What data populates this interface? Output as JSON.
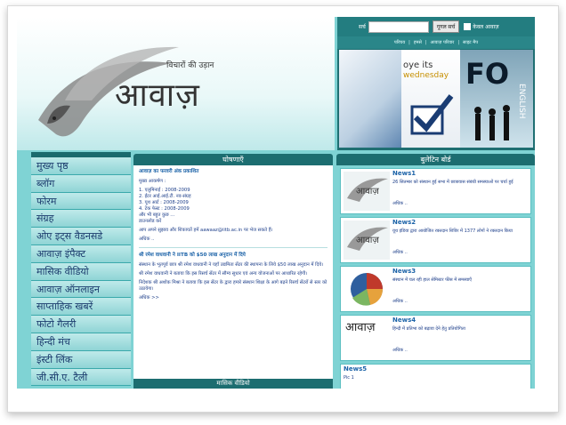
{
  "header": {
    "tagline": "विचारों की उड़ान",
    "logo_text": "आवाज़"
  },
  "search": {
    "label": "सर्च",
    "placeholder": "",
    "button": "गूगल सर्च",
    "checkbox_label": "केवल आवाज़"
  },
  "topnav": [
    "परिचय",
    "हमसे",
    "आवाज़ परिवार",
    "साइट मैप"
  ],
  "banner": {
    "line1": "oye its",
    "line2": "wednesday",
    "big": "FO",
    "vertical": "ENGLISH"
  },
  "sidebar": {
    "items": [
      "मुख्य पृष्ठ",
      "ब्लॉग",
      "फोरम",
      "संग्रह",
      "ओए इट्स वैडनसडे",
      "आवाज़ इंपैक्ट",
      "मासिक वीडियो",
      "आवाज़ ऑनलाइन",
      "साप्ताहिक खबरें",
      "फोटो गैलरी",
      "हिन्दी मंच",
      "इंस्टी लिंक",
      "जी.सी.ए. टैली"
    ]
  },
  "announcements": {
    "title": "घोषणाएँ",
    "item1_title": "आवाज़ का फरवरी अंक प्रकाशित",
    "item1_intro": "मुख्य आकर्षण :",
    "item1_points": [
      "1. एलुमिनाई : 2008-2009",
      "2. ईंटर आई.आई.टी. नव-संग्रह",
      "3. यूथ आर्ट : 2008-2009",
      "4. टेक फेस्ट : 2008-2009",
      "और भी बहुत कुछ ..."
    ],
    "item1_extra": "डाउनलोड करें",
    "item1_note": "आप अपने सुझाव और शिकायतें हमें aawaaz@iitb.ac.in पर भेज सकते हैं।",
    "item1_more": "अधिक ..",
    "item2_title": "श्री रमेश वाधवानी ने IITB को $50 लाख अनुदान में दिये",
    "item2_p1": "संस्थान के भूतपूर्व छात्र श्री रमेश वाधवानी ने यहाँ उद्यमिता सेंटर की स्थापना के लिये $50 लाख अनुदान में दिये।",
    "item2_p2": "श्री रमेश वाधवानी ने बताया कि इस रिसर्च सेंटर में सौम्य सुधार एवं अन्य योजनाओं पर आधारित रहेगी।",
    "item2_p3": "निदेशक श्री अशोक मिश्रा ने बताया कि इस सेंटर के द्वारा हमारे संस्थान शिक्षा के आगे बढ़ने रिसर्च सेंटरों से स्तर को उठायेगा।",
    "item2_more": "अधिक >>",
    "footer_title": "मासिक वीडियो"
  },
  "bulletin": {
    "title": "बुलेटिन बोर्ड",
    "items": [
      {
        "title": "News1",
        "text": "26 सितम्बर को संस्थान हुई सभा में छात्रावास संबंधी समस्याओं पर चर्चा हुई",
        "more": "अधिक ..",
        "thumb": "आवाज़"
      },
      {
        "title": "News2",
        "text": "यूथ इंडिया द्वारा आयोजित रक्तदान शिविर में 1377 लोगों ने रक्तदान किया",
        "more": "अधिक ..",
        "thumb": "आवाज़"
      },
      {
        "title": "News3",
        "text": "संस्थान में चल रही हाल सेमिस्टर फीस में समस्याएँ",
        "more": "अधिक ..",
        "thumb": ""
      },
      {
        "title": "News4",
        "text": "हिन्दी में प्रतिभा को बढ़ावा देने हेतु प्रतियोगिता",
        "more": "अधिक ..",
        "thumb": "आवाज़"
      },
      {
        "title": "News5",
        "text": "Pic 1",
        "more": "",
        "thumb": ""
      }
    ]
  }
}
